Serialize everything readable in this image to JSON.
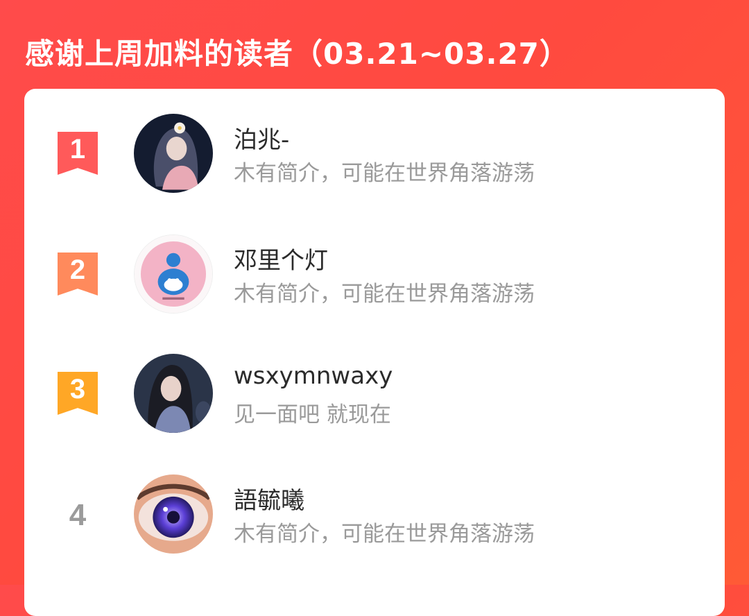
{
  "header": {
    "title": "感谢上周加料的读者（03.21~03.27）"
  },
  "readers": [
    {
      "rank": "1",
      "name": "泊兆-",
      "bio": "木有简介，可能在世界角落游荡",
      "ribbon_color": "#ff5a5a"
    },
    {
      "rank": "2",
      "name": "邓里个灯",
      "bio": "木有简介，可能在世界角落游荡",
      "ribbon_color": "#ff8a5c"
    },
    {
      "rank": "3",
      "name": "wsxymnwaxy",
      "bio": "见一面吧 就现在",
      "ribbon_color": "#ffa726"
    },
    {
      "rank": "4",
      "name": "語毓曦",
      "bio": "木有简介，可能在世界角落游荡",
      "ribbon_color": ""
    }
  ]
}
